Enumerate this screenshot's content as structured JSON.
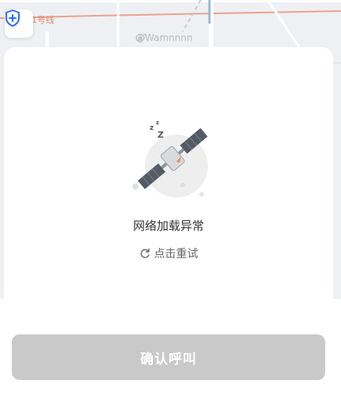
{
  "map": {
    "line_label": "1号线",
    "watermark": "@Wamnnnn"
  },
  "error": {
    "message": "网络加载异常",
    "retry_label": "点击重试"
  },
  "footer": {
    "confirm_label": "确认呼叫"
  },
  "colors": {
    "button_disabled": "#c9c9c9",
    "shield_accent": "#2f6bff",
    "map_line": "#e0896a"
  },
  "icons": {
    "shield": "shield-plus-icon",
    "retry": "refresh-icon",
    "illustration": "sleeping-satellite-icon"
  }
}
